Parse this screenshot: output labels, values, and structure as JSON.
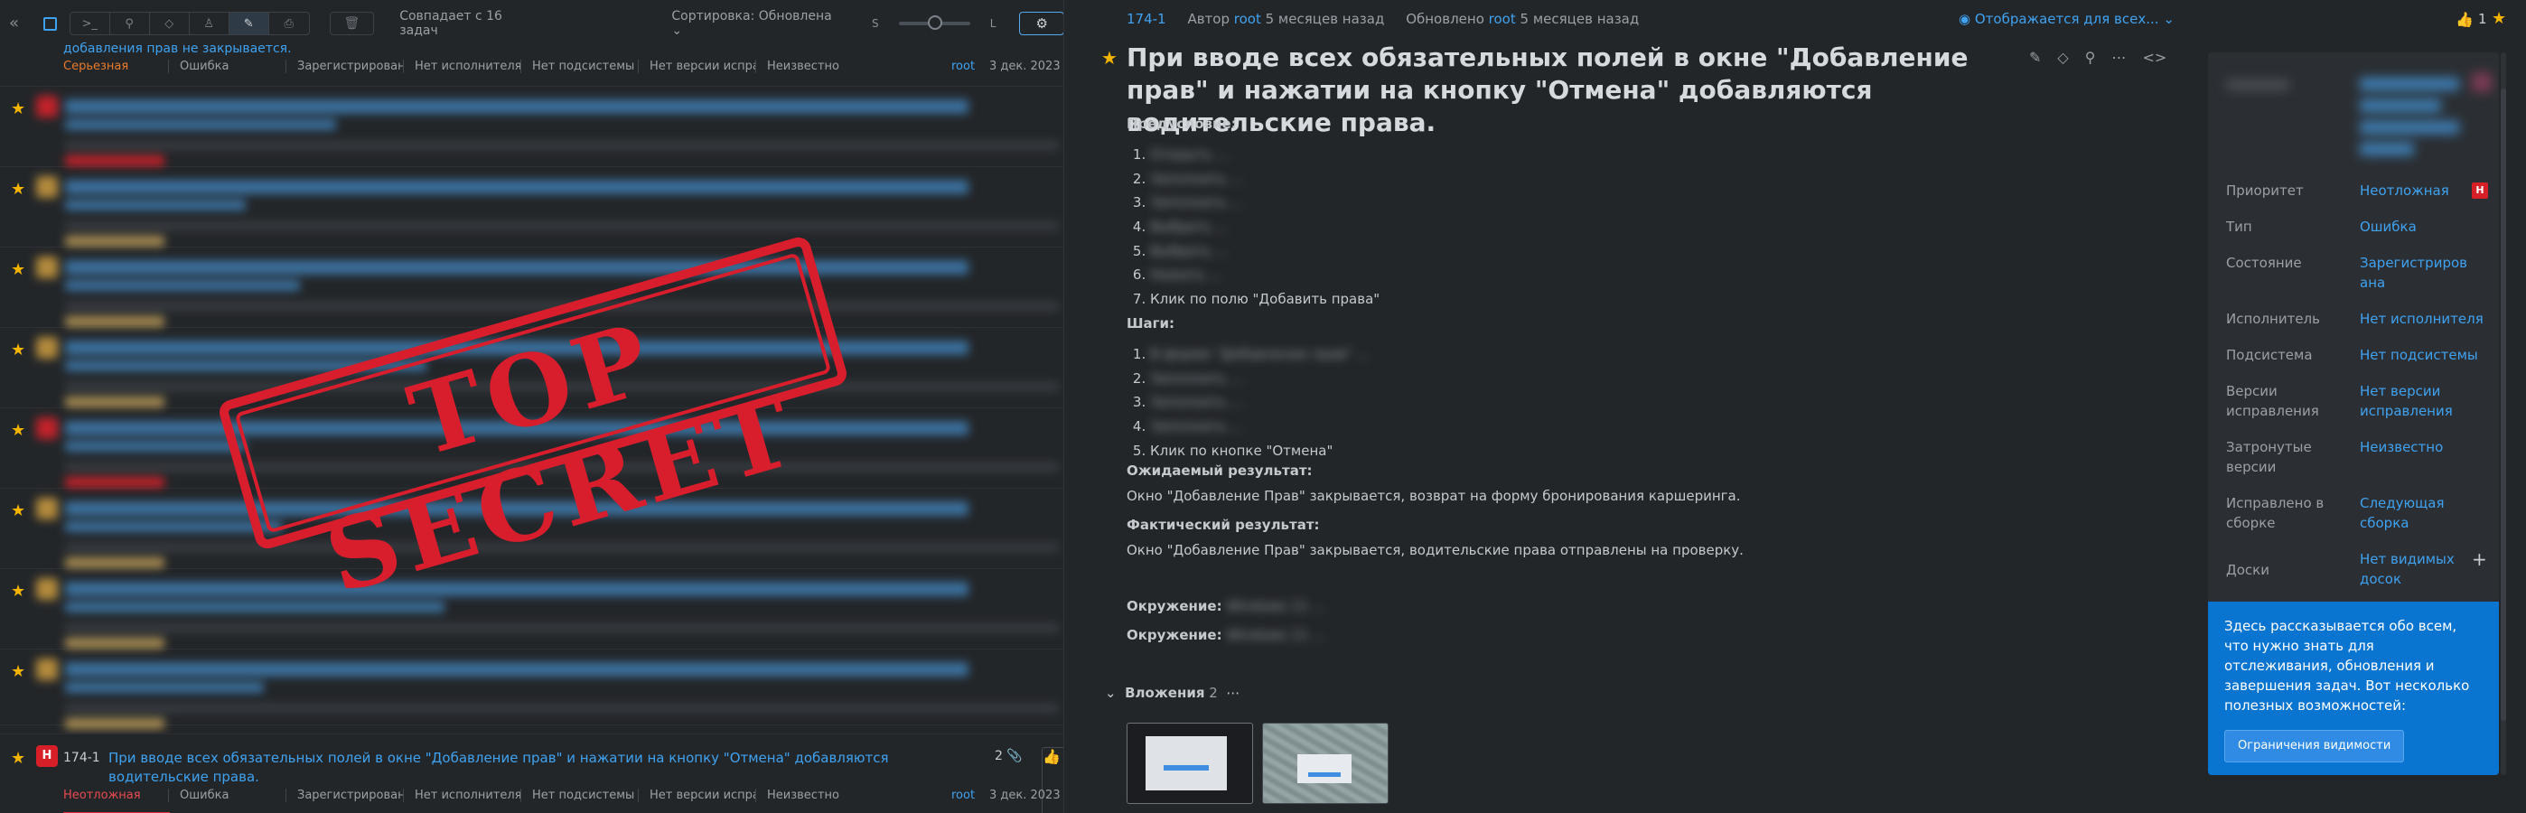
{
  "toolbar": {
    "count_label": "Совпадает с 16 задач",
    "sort_label": "Сортировка: Обновлена",
    "size_small": "S",
    "size_large": "L"
  },
  "first_row": {
    "title_fragment": "добавления прав не закрывается.",
    "severity": "Серьезная",
    "type": "Ошибка",
    "state": "Зарегистрирован",
    "assignee": "Нет исполнителя",
    "subsystem": "Нет подсистемы",
    "fix_version": "Нет версии испра",
    "affected": "Неизвестно",
    "author": "root",
    "date": "3 дек. 2023"
  },
  "selected_row": {
    "priority_badge": "H",
    "key": "174-1",
    "title": "При вводе всех обязательных полей в окне \"Добавление прав\" и нажатии на кнопку \"Отмена\" добавляются водительские права.",
    "attachments": "2",
    "priority": "Неотложная",
    "type": "Ошибка",
    "state": "Зарегистрирован",
    "assignee": "Нет исполнителя",
    "subsystem": "Нет подсистемы",
    "fix_version": "Нет версии испра",
    "affected": "Неизвестно",
    "author": "root",
    "date": "3 дек. 2023"
  },
  "stamp": {
    "text": "TOP SECRET"
  },
  "issue": {
    "key": "174-1",
    "author_prefix": "Автор",
    "author": "root",
    "created": "5 месяцев назад",
    "updated_prefix": "Обновлено",
    "updated_by": "root",
    "updated": "5 месяцев назад",
    "visibility": "Отображается для всех...",
    "title": "При вводе всех обязательных полей в окне \"Добавление прав\" и нажатии на кнопку \"Отмена\" добавляются водительские права.",
    "precondition_label": "Предусловие:",
    "precondition_steps": [
      "Открыть ...",
      "Заполнить ...",
      "Заполнить ...",
      "Выбрать ...",
      "Выбрать ...",
      "Нажать ...",
      "Клик по полю \"Добавить права\""
    ],
    "steps_label": "Шаги:",
    "steps": [
      "В форме \"Добавление прав\" ...",
      "Заполнить ...",
      "Заполнить ...",
      "Заполнить ...",
      "Клик по кнопке \"Отмена\""
    ],
    "expected_label": "Ожидаемый результат:",
    "expected": "Окно \"Добавление Прав\" закрывается, возврат на форму бронирования каршеринга.",
    "actual_label": "Фактический результат:",
    "actual": "Окно \"Добавление Прав\" закрывается, водительские права отправлены на проверку.",
    "env_label": "Окружение:",
    "env1": "Windows 11 ...",
    "env2": "Windows 11 ...",
    "attachments_label": "Вложения",
    "attachments_count": "2"
  },
  "sidebar": {
    "likes": "1",
    "fields": [
      {
        "label": "Приоритет",
        "value": "Неотложная",
        "badge": "H"
      },
      {
        "label": "Тип",
        "value": "Ошибка"
      },
      {
        "label": "Состояние",
        "value": "Зарегистрирована"
      },
      {
        "label": "Исполнитель",
        "value": "Нет исполнителя"
      },
      {
        "label": "Подсистема",
        "value": "Нет подсистемы"
      },
      {
        "label": "Версии исправления",
        "value": "Нет версии исправления"
      },
      {
        "label": "Затронутые версии",
        "value": "Неизвестно"
      },
      {
        "label": "Исправлено в сборке",
        "value": "Следующая сборка"
      },
      {
        "label": "Доски",
        "value": "Нет видимых досок"
      }
    ],
    "info_text": "Здесь рассказывается обо всем, что нужно знать для отслеживания, обновления и завершения задач. Вот несколько полезных возможностей:",
    "info_button": "Ограничения видимости"
  },
  "colors": {
    "accent": "#3fa2f0",
    "star": "#f4b400",
    "critical": "#d61f26",
    "stamp": "#d81e2c",
    "info_bg": "#0a74d1"
  }
}
